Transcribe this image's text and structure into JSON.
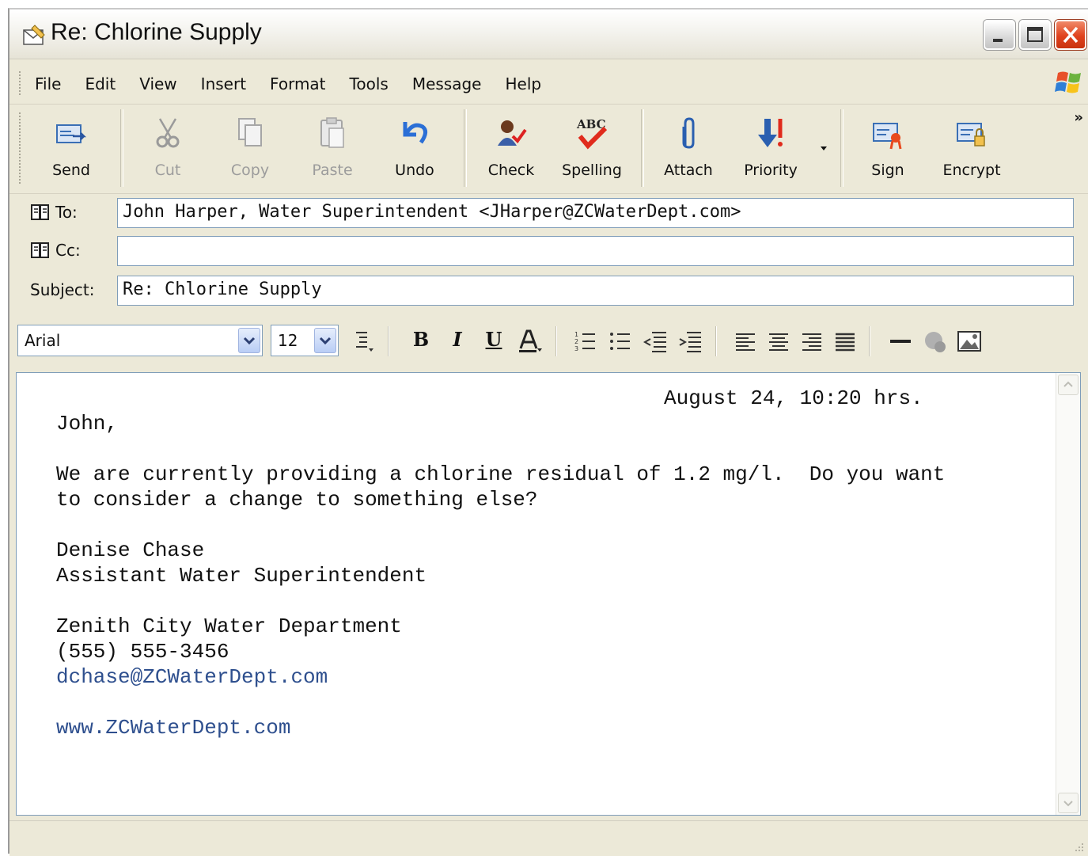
{
  "window": {
    "title": "Re: Chlorine Supply"
  },
  "menu": [
    "File",
    "Edit",
    "View",
    "Insert",
    "Format",
    "Tools",
    "Message",
    "Help"
  ],
  "toolbar": {
    "send": "Send",
    "cut": "Cut",
    "copy": "Copy",
    "paste": "Paste",
    "undo": "Undo",
    "check": "Check",
    "spelling": "Spelling",
    "attach": "Attach",
    "priority": "Priority",
    "sign": "Sign",
    "encrypt": "Encrypt"
  },
  "header": {
    "to_label": "To:",
    "to_value": "John Harper, Water Superintendent <JHarper@ZCWaterDept.com>",
    "cc_label": "Cc:",
    "cc_value": "",
    "subject_label": "Subject:",
    "subject_value": "Re: Chlorine Supply"
  },
  "format": {
    "font": "Arial",
    "size": "12"
  },
  "body": {
    "date": "August 24, 10:20 hrs.",
    "greeting": "John,",
    "line1": "We are currently providing a chlorine residual of 1.2 mg/l.  Do you want",
    "line2": "to consider a change to something else?",
    "sig_name": "Denise Chase",
    "sig_title": "Assistant Water Superintendent",
    "org": "Zenith City Water Department",
    "phone": "(555) 555-3456",
    "email": "dchase@ZCWaterDept.com",
    "website": "www.ZCWaterDept.com"
  },
  "colors": {
    "link": "#2e4f8e",
    "window_bg": "#ece9d8",
    "input_border": "#7f9db9"
  }
}
